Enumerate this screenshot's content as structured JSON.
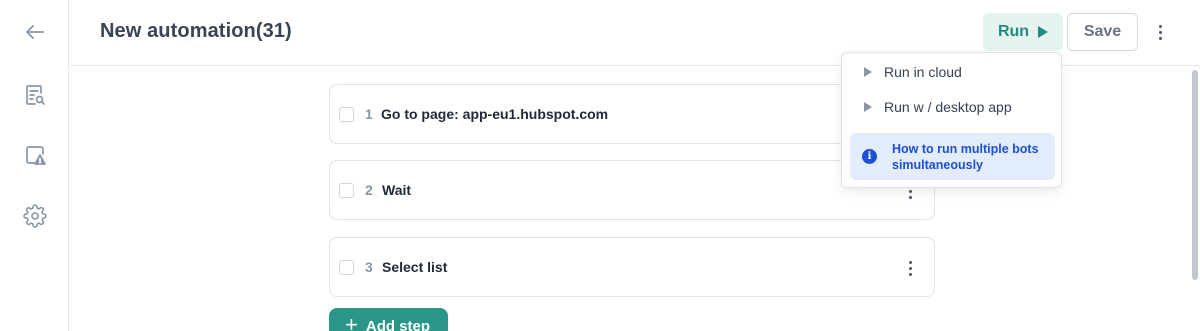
{
  "header": {
    "title": "New automation(31)",
    "run_label": "Run",
    "save_label": "Save"
  },
  "sidebar": {
    "items": [
      {
        "icon": "back-arrow-icon"
      },
      {
        "icon": "search-document-icon"
      },
      {
        "icon": "alert-monitor-icon"
      },
      {
        "icon": "gear-icon"
      }
    ]
  },
  "steps": [
    {
      "number": "1",
      "label": "Go to page: app-eu1.hubspot.com"
    },
    {
      "number": "2",
      "label": "Wait"
    },
    {
      "number": "3",
      "label": "Select list"
    }
  ],
  "add_step_label": "Add step",
  "run_menu": {
    "items": [
      "Run in cloud",
      "Run w / desktop app"
    ],
    "info": "How to run multiple bots simultaneously"
  },
  "colors": {
    "accent": "#2a9688",
    "run_bg": "#e6f4f1",
    "info_bg": "#e3ecfb",
    "info_text": "#1d4fd8"
  }
}
